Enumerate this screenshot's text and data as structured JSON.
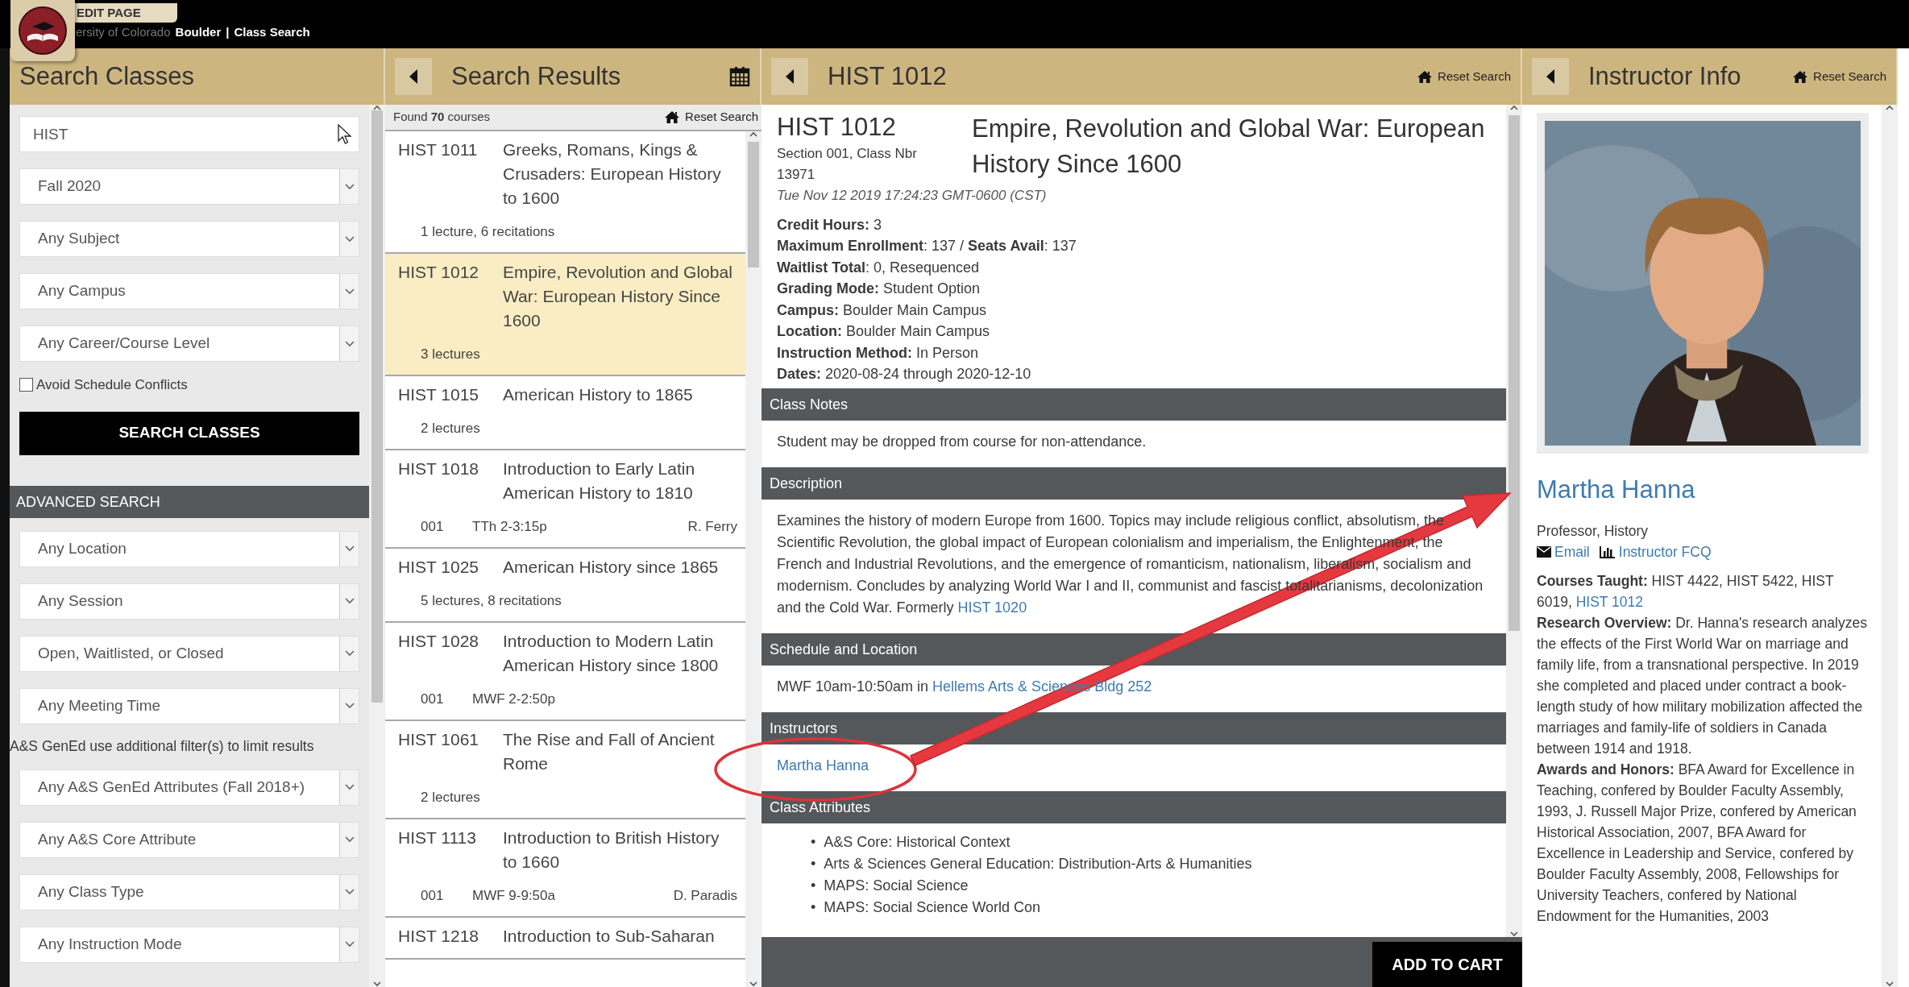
{
  "top_bar": {
    "edit_label": "EDIT PAGE",
    "site_cut": "ersity of Colorado",
    "site_bold": "Boulder",
    "separator": "|",
    "app": "Class Search"
  },
  "search_panel": {
    "title": "Search Classes",
    "fields": [
      {
        "kind": "text",
        "value": "HIST"
      },
      {
        "kind": "select",
        "value": "Fall 2020"
      },
      {
        "kind": "select",
        "value": "Any Subject"
      },
      {
        "kind": "select",
        "value": "Any Campus"
      },
      {
        "kind": "select",
        "value": "Any Career/Course Level"
      }
    ],
    "checkbox": {
      "label": "Avoid Schedule Conflicts",
      "checked": false
    },
    "button": "SEARCH CLASSES",
    "advanced_title": "ADVANCED SEARCH",
    "advanced": [
      {
        "kind": "select",
        "value": "Any Location"
      },
      {
        "kind": "select",
        "value": "Any Session"
      },
      {
        "kind": "select",
        "value": "Open, Waitlisted, or Closed"
      },
      {
        "kind": "select",
        "value": "Any Meeting Time"
      },
      {
        "kind": "note",
        "value": "A&S GenEd use additional filter(s) to limit results"
      },
      {
        "kind": "select",
        "value": "Any A&S GenEd Attributes (Fall 2018+)"
      },
      {
        "kind": "select",
        "value": "Any A&S Core Attribute"
      },
      {
        "kind": "select",
        "value": "Any Class Type"
      },
      {
        "kind": "select",
        "value": "Any Instruction Mode"
      }
    ]
  },
  "results_panel": {
    "title": "Search Results",
    "found": "Found **70** courses",
    "reset": "Reset Search",
    "courses": [
      {
        "code": "HIST 1011",
        "title": "Greeks, Romans, Kings & Crusaders: European History to 1600",
        "selected": false,
        "kind": "summary",
        "meta": [
          "1 lecture, 6 recitations"
        ]
      },
      {
        "code": "HIST 1012",
        "title": "Empire, Revolution and Global War: European History Since 1600",
        "selected": true,
        "kind": "summary",
        "meta": [
          "3 lectures"
        ]
      },
      {
        "code": "HIST 1015",
        "title": "American History to 1865",
        "selected": false,
        "kind": "summary",
        "meta": [
          "2 lectures"
        ]
      },
      {
        "code": "HIST 1018",
        "title": "Introduction to Early Latin American History to 1810",
        "selected": false,
        "kind": "section",
        "meta": [
          "001",
          "TTh 2-3:15p",
          "R. Ferry"
        ]
      },
      {
        "code": "HIST 1025",
        "title": "American History since 1865",
        "selected": false,
        "kind": "summary",
        "meta": [
          "5 lectures, 8 recitations"
        ]
      },
      {
        "code": "HIST 1028",
        "title": "Introduction to Modern Latin American History since 1800",
        "selected": false,
        "kind": "section",
        "meta": [
          "001",
          "MWF 2-2:50p"
        ]
      },
      {
        "code": "HIST 1061",
        "title": "The Rise and Fall of Ancient Rome",
        "selected": false,
        "kind": "summary",
        "meta": [
          "2 lectures"
        ]
      },
      {
        "code": "HIST 1113",
        "title": "Introduction to British History to 1660",
        "selected": false,
        "kind": "section",
        "meta": [
          "001",
          "MWF 9-9:50a",
          "D. Paradis"
        ]
      },
      {
        "code": "HIST 1218",
        "title": "Introduction to Sub-Saharan",
        "selected": false
      }
    ]
  },
  "detail_panel": {
    "title": "HIST 1012",
    "reset": "Reset Search",
    "code": "HIST 1012",
    "section": "Section 001, Class Nbr 13971",
    "timestamp": "Tue Nov 12 2019 17:24:23 GMT-0600 (CST)",
    "course_title": "Empire, Revolution and Global War: European History Since 1600",
    "facts": [
      "**Credit Hours:** 3",
      "**Maximum Enrollment**: 137 / **Seats Avail**: 137",
      "**Waitlist Total**: 0, Resequenced",
      "**Grading Mode:** Student Option",
      "**Campus:** Boulder Main Campus",
      "**Location:** Boulder Main Campus",
      "**Instruction Method:** In Person",
      "**Dates:** 2020-08-24 through 2020-12-10"
    ],
    "sections": [
      {
        "heading": "Class Notes",
        "kind": "text",
        "text": "Student may be dropped from course for non-attendance."
      },
      {
        "heading": "Description",
        "kind": "text",
        "text": "Examines the history of modern Europe from 1600. Topics may include religious conflict, absolutism, the Scientific Revolution, the global impact of European colonialism and imperialism, the Enlightenment, the French and Industrial Revolutions, and the emergence of romanticism, nationalism, liberalism, socialism and modernism. Concludes by analyzing World War I and II, communist and fascist totalitarianisms, decolonization and the Cold War. Formerly ",
        "link": "HIST 1020"
      },
      {
        "heading": "Schedule and Location",
        "kind": "text",
        "text": "MWF 10am-10:50am in ",
        "link": "Hellems Arts & Sciences Bldg 252"
      },
      {
        "heading": "Instructors",
        "kind": "link",
        "link": "Martha Hanna"
      },
      {
        "heading": "Class Attributes",
        "kind": "list",
        "marker": "•",
        "items": [
          "A&S Core: Historical Context",
          "Arts & Sciences General Education: Distribution-Arts & Humanities",
          "MAPS: Social Science",
          "MAPS: Social Science World Con"
        ]
      }
    ],
    "button": "ADD TO CART"
  },
  "instructor_panel": {
    "title": "Instructor Info",
    "reset": "Reset Search",
    "photo": {
      "kind": "picture"
    },
    "name": "Martha Hanna",
    "position": "Professor, History",
    "email": "Email",
    "fcq": "Instructor FCQ",
    "courses": "**Courses Taught:** HIST 4422, HIST 5422, HIST 6019, ",
    "courses_link": "HIST 1012",
    "paragraphs": [
      "**Research Overview:** Dr. Hanna's research analyzes the effects of the First World War on marriage and family life, from a transnational perspective. In 2019 she completed and placed under contract a book-length study of how military mobilization affected the marriages and family-life of soldiers in Canada between 1914 and 1918.",
      "**Awards and Honors:** BFA Award for Excellence in Teaching, confered by Boulder Faculty Assembly, 1993, J. Russell Major Prize, confered by American Historical Association, 2007, BFA Award for Excellence in Leadership and Service, confered by Boulder Faculty Assembly, 2008, Fellowships for University Teachers, confered by National Endowment for the Humanities, 2003"
    ]
  }
}
